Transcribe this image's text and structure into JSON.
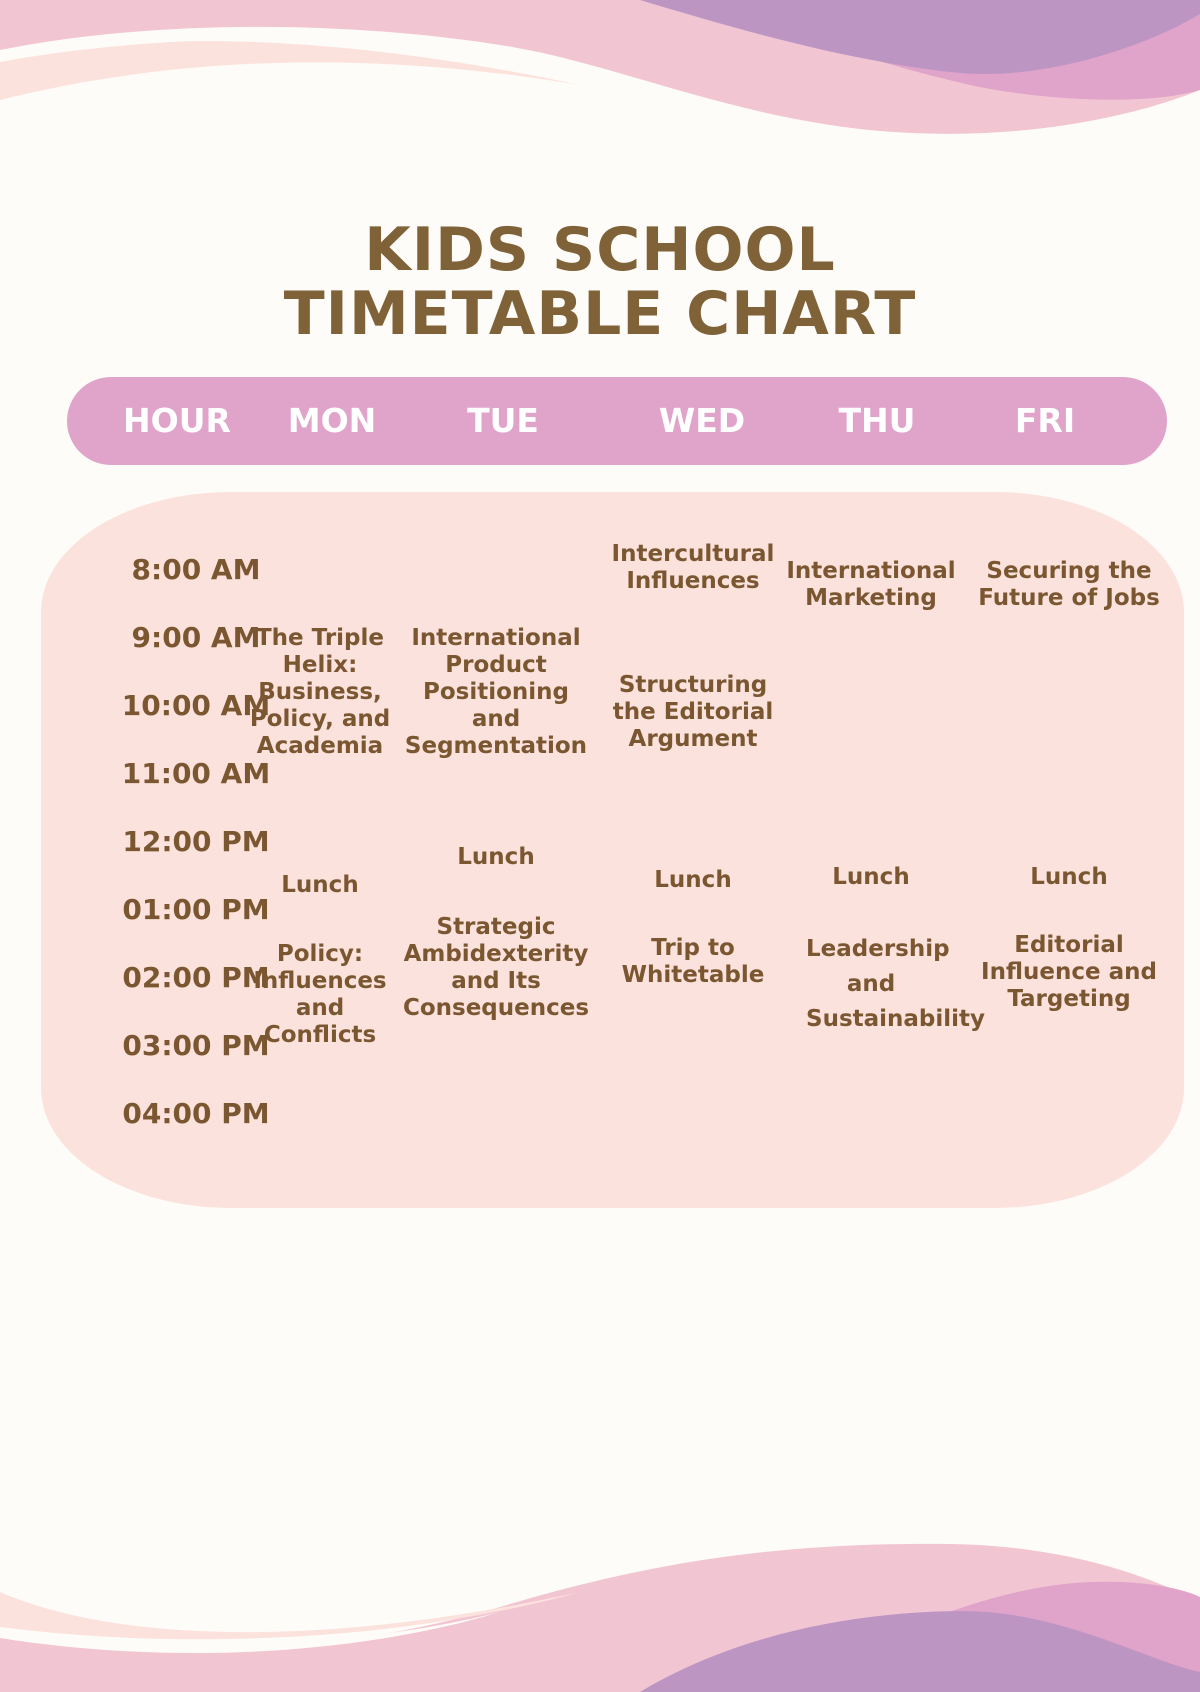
{
  "title": {
    "line1": "KIDS SCHOOL",
    "line2": "TIMETABLE CHART"
  },
  "colors": {
    "background": "#fefcf8",
    "header_bar": "#e0a3c9",
    "panel": "#fce2dd",
    "text": "#7a5731",
    "header_text": "#ffffff",
    "wave_purple": "#bd95c3",
    "wave_pink": "#f2c5d3",
    "wave_mauve": "#e0a3c9",
    "wave_peach": "#fce2dd"
  },
  "header": [
    "HOUR",
    "MON",
    "TUE",
    "WED",
    "THU",
    "FRI"
  ],
  "times": [
    "8:00 AM",
    "9:00 AM",
    "10:00 AM",
    "11:00 AM",
    "12:00 PM",
    "01:00 PM",
    "02:00 PM",
    "03:00 PM",
    "04:00 PM"
  ],
  "schedule": {
    "mon": {
      "morning": "The Triple Helix: Business, Policy, and Academia",
      "lunch": "Lunch",
      "afternoon": "Policy: Influences and Conflicts"
    },
    "tue": {
      "morning": "International Product Positioning and Segmentation",
      "lunch": "Lunch",
      "afternoon": "Strategic Ambidexterity and Its Consequences"
    },
    "wed": {
      "early": "Intercultural Influences",
      "morning": "Structuring the Editorial Argument",
      "lunch": "Lunch",
      "afternoon": "Trip to Whitetable"
    },
    "thu": {
      "early": "International Marketing",
      "lunch": "Lunch",
      "afternoon": "Leadership and Sustainability"
    },
    "fri": {
      "early": "Securing the Future of Jobs",
      "lunch": "Lunch",
      "afternoon": "Editorial Influence and Targeting"
    }
  }
}
